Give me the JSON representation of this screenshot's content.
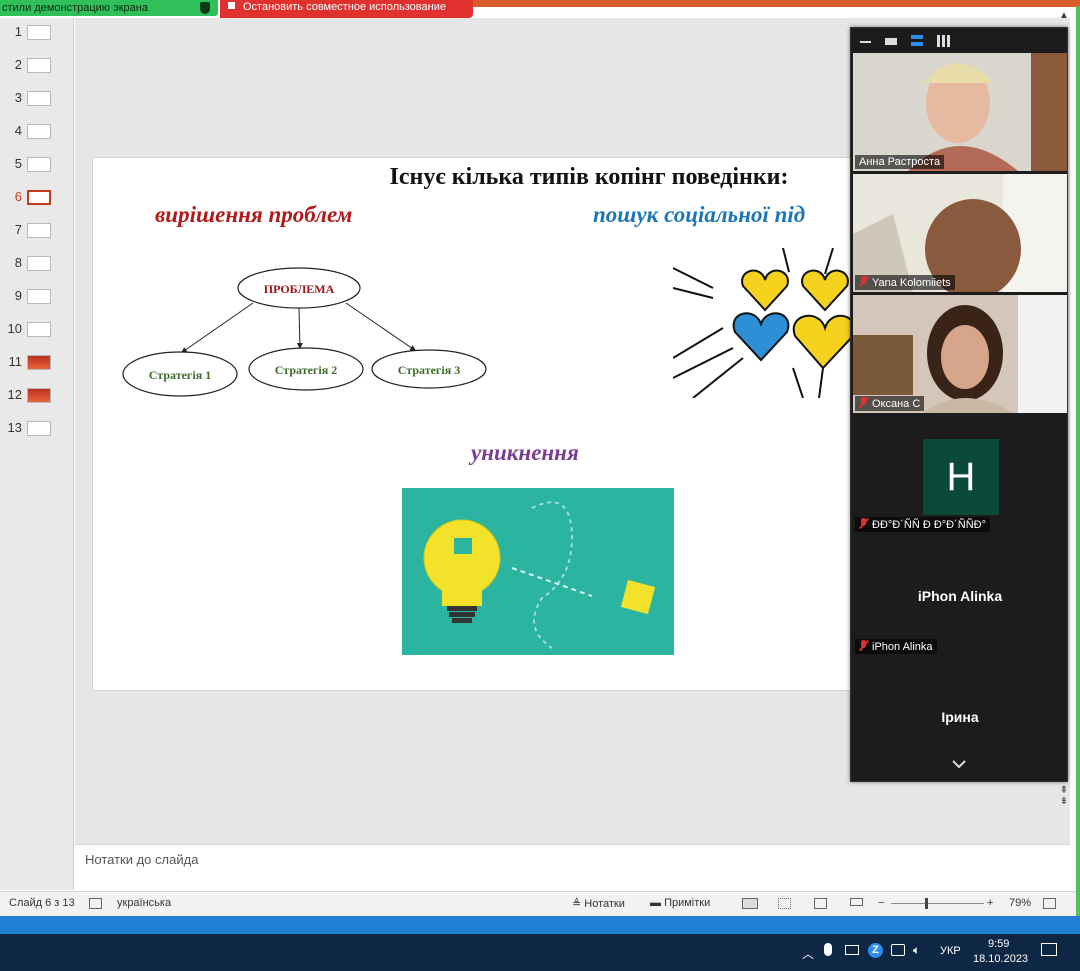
{
  "share": {
    "left_label": "стили демонстрацию экрана",
    "stop_label": "Остановить совместное использование"
  },
  "thumbnails": [
    {
      "num": "1"
    },
    {
      "num": "2"
    },
    {
      "num": "3"
    },
    {
      "num": "4"
    },
    {
      "num": "5"
    },
    {
      "num": "6"
    },
    {
      "num": "7"
    },
    {
      "num": "8"
    },
    {
      "num": "9"
    },
    {
      "num": "10"
    },
    {
      "num": "11"
    },
    {
      "num": "12"
    },
    {
      "num": "13"
    }
  ],
  "slide": {
    "title": "Існує кілька типів копінг поведінки:",
    "heading_red": "вирішення проблем",
    "heading_blue": "пошук соціальної під",
    "heading_purple": "уникнення",
    "diagram": {
      "center": "ПРОБЛЕМА",
      "s1": "Стратегія 1",
      "s2": "Стратегія 2",
      "s3": "Стратегія 3"
    }
  },
  "notes": {
    "placeholder": "Нотатки до слайда"
  },
  "status": {
    "slide_counter": "Слайд 6 з 13",
    "language": "українська",
    "notes_label": "Нотатки",
    "comments_label": "Примітки",
    "zoom": "79%",
    "minus": "−",
    "plus": "+"
  },
  "zoom_panel": {
    "participants": [
      {
        "name": "Анна Растроста"
      },
      {
        "name": "Yana Kolomiiets"
      },
      {
        "name": "Оксана С"
      },
      {
        "name": "ÐÐ°Ð´ÑÑ Ð Ð°Ð´ÑÑÐ°",
        "initial": "H"
      },
      {
        "name": "iPhon Alinka",
        "center": "iPhon Alinka"
      },
      {
        "name": "Ірина",
        "center": "Ірина"
      }
    ]
  },
  "taskbar": {
    "lang": "УКР",
    "time": "9:59",
    "date": "18.10.2023"
  },
  "colors": {
    "share_green": "#2fc05a",
    "share_red": "#e0312f",
    "active_slide": "#c43b1d",
    "title_red": "#b01a1a",
    "title_blue": "#1b76b8",
    "title_purple": "#7a3d96",
    "taskbar": "#0e2744"
  }
}
